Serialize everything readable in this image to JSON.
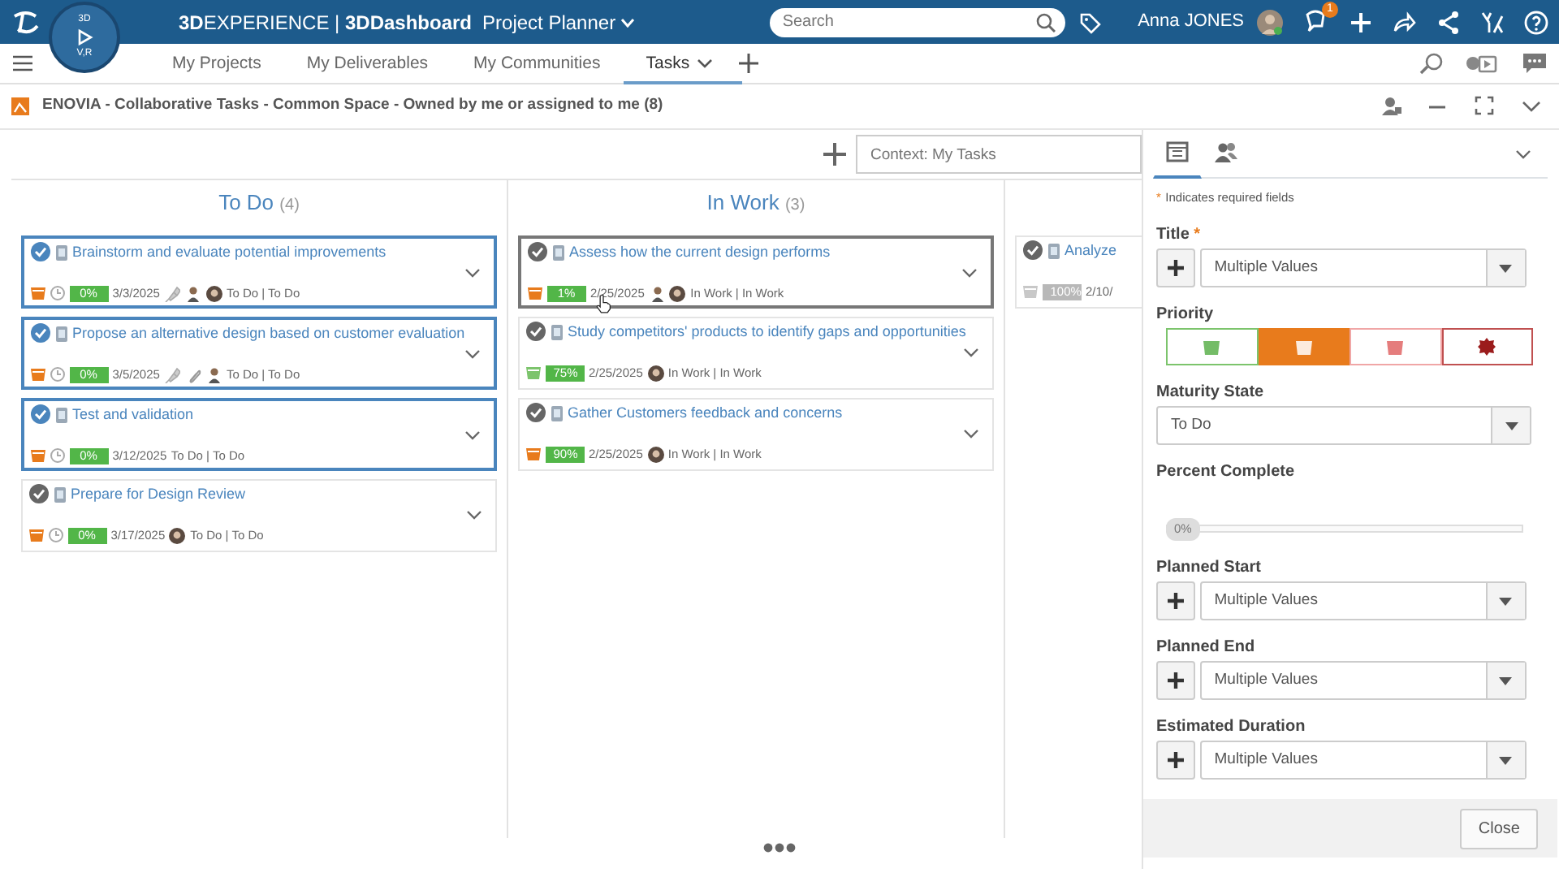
{
  "topbar": {
    "brand": "**3D**EXPERIENCE | **3DDashboard**",
    "app": "Project Planner",
    "compass_labels": [
      "3D",
      "V,R"
    ],
    "search": {
      "placeholder": "Search"
    },
    "user": "Anna JONES",
    "notification_count": "1"
  },
  "tabs": [
    {
      "label": "My Projects",
      "selected": false
    },
    {
      "label": "My Deliverables",
      "selected": false
    },
    {
      "label": "My Communities",
      "selected": false
    },
    {
      "label": "Tasks",
      "selected": true
    }
  ],
  "widget": {
    "title": "ENOVIA - Collaborative Tasks - Common Space - Owned by me or assigned to me (8)"
  },
  "board": {
    "context": {
      "placeholder": "Context: My Tasks"
    },
    "columns": [
      {
        "title": "To Do",
        "count": "(4)",
        "cards": [
          {
            "title": "Brainstorm and evaluate potential improvements",
            "selected": true,
            "hovered": false,
            "color": "#e87b1c",
            "clock": true,
            "percent": "0%",
            "finished": false,
            "date": "3/3/2025",
            "icons": [
              {
                "kind": "pin"
              },
              {
                "kind": "man"
              },
              {
                "kind": "woman"
              }
            ],
            "state": "To Do | To Do"
          },
          {
            "title": "Propose an alternative design based on customer evaluation",
            "selected": true,
            "hovered": false,
            "color": "#e87b1c",
            "clock": true,
            "percent": "0%",
            "finished": false,
            "date": "3/5/2025",
            "icons": [
              {
                "kind": "pin"
              },
              {
                "kind": "clip"
              },
              {
                "kind": "man"
              }
            ],
            "state": "To Do | To Do"
          },
          {
            "title": "Test and validation",
            "selected": true,
            "hovered": false,
            "color": "#e87b1c",
            "clock": true,
            "percent": "0%",
            "finished": false,
            "date": "3/12/2025",
            "state": "To Do | To Do"
          },
          {
            "title": "Prepare for Design Review",
            "selected": false,
            "hovered": false,
            "color": "#e87b1c",
            "clock": true,
            "percent": "0%",
            "finished": false,
            "date": "3/17/2025",
            "icons": [
              {
                "kind": "woman"
              }
            ],
            "state": "To Do | To Do"
          }
        ]
      },
      {
        "title": "In Work",
        "count": "(3)",
        "cards": [
          {
            "title": "Assess how the current design performs",
            "selected": false,
            "hovered": true,
            "color": "#e87b1c",
            "clock": false,
            "percent": "1%",
            "finished": false,
            "date": "2/25/2025",
            "icons": [
              {
                "kind": "man"
              },
              {
                "kind": "woman"
              }
            ],
            "state": "In Work | In Work",
            "cursor": true
          },
          {
            "title": "Study competitors' products to identify gaps and opportunities",
            "selected": false,
            "hovered": false,
            "color": "#7cc46c",
            "clock": false,
            "percent": "75%",
            "finished": false,
            "date": "2/25/2025",
            "icons": [
              {
                "kind": "woman"
              }
            ],
            "state": "In Work | In Work"
          },
          {
            "title": "Gather Customers feedback and concerns",
            "selected": false,
            "hovered": false,
            "color": "#e87b1c",
            "clock": false,
            "percent": "90%",
            "finished": false,
            "date": "2/25/2025",
            "icons": [
              {
                "kind": "woman"
              }
            ],
            "state": "In Work | In Work"
          }
        ]
      },
      {
        "cards": [
          {
            "title": "Analyze",
            "selected": false,
            "hovered": false,
            "color": "#c8c8c8",
            "clock": false,
            "percent": "100%",
            "finished": true,
            "date": "2/10/"
          }
        ]
      }
    ]
  },
  "panel": {
    "tabs": [
      {
        "kind": "form",
        "selected": true
      },
      {
        "kind": "people",
        "selected": false
      }
    ],
    "required_note": {
      "mark": "*",
      "text": "Indicates required fields"
    },
    "fields": [
      {
        "kind": "combo",
        "label": "Title",
        "required": true,
        "value": "Multiple Values"
      },
      {
        "kind": "priority",
        "label": "Priority",
        "options": [
          {
            "kind": "low",
            "selected": false
          },
          {
            "kind": "medium",
            "selected": true
          },
          {
            "kind": "high",
            "selected": false
          },
          {
            "kind": "critical",
            "selected": false
          }
        ]
      },
      {
        "kind": "select",
        "label": "Maturity State",
        "value": "To Do"
      },
      {
        "kind": "slider",
        "label": "Percent Complete",
        "level": 0,
        "reading": "0%"
      },
      {
        "kind": "combo",
        "label": "Planned Start",
        "value": "Multiple Values"
      },
      {
        "kind": "combo",
        "label": "Planned End",
        "value": "Multiple Values"
      },
      {
        "kind": "combo",
        "label": "Estimated Duration",
        "value": "Multiple Values"
      }
    ],
    "close": "Close"
  }
}
